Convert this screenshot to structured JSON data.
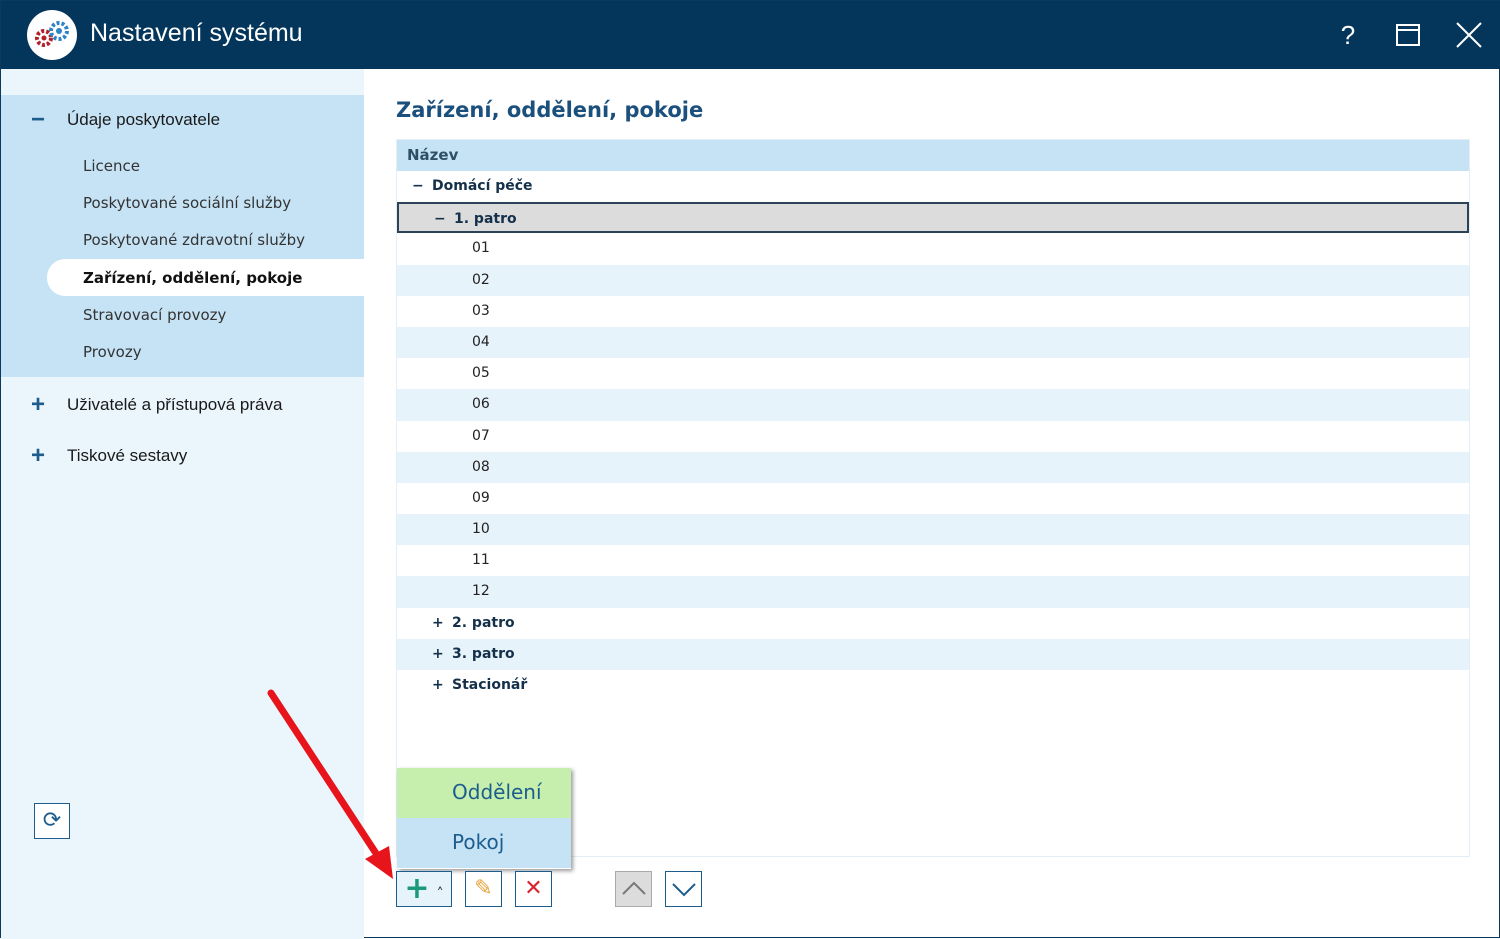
{
  "window": {
    "title": "Nastavení systému",
    "help": "?",
    "maximize": "☐",
    "close": "✕"
  },
  "sidebar": {
    "sections": [
      {
        "label": "Údaje poskytovatele",
        "toggle": "−",
        "items": [
          "Licence",
          "Poskytované sociální služby",
          "Poskytované zdravotní služby",
          "Zařízení, oddělení, pokoje",
          "Stravovací provozy",
          "Provozy"
        ],
        "selected": "Zařízení, oddělení, pokoje"
      },
      {
        "label": "Uživatelé a přístupová práva",
        "toggle": "+"
      },
      {
        "label": "Tiskové sestavy",
        "toggle": "+"
      }
    ],
    "refresh": "⟳"
  },
  "main": {
    "title": "Zařízení, oddělení, pokoje",
    "column": "Název",
    "rows": [
      {
        "toggle": "−",
        "label": "Domácí péče",
        "level": 0
      },
      {
        "toggle": "−",
        "label": "1. patro",
        "level": 1
      },
      {
        "label": "01",
        "level": 2
      },
      {
        "label": "02",
        "level": 2
      },
      {
        "label": "03",
        "level": 2
      },
      {
        "label": "04",
        "level": 2
      },
      {
        "label": "05",
        "level": 2
      },
      {
        "label": "06",
        "level": 2
      },
      {
        "label": "07",
        "level": 2
      },
      {
        "label": "08",
        "level": 2
      },
      {
        "label": "09",
        "level": 2
      },
      {
        "label": "10",
        "level": 2
      },
      {
        "label": "11",
        "level": 2
      },
      {
        "label": "12",
        "level": 2
      },
      {
        "toggle": "+",
        "label": "2. patro",
        "level": 1
      },
      {
        "toggle": "+",
        "label": "3. patro",
        "level": 1
      },
      {
        "toggle": "+",
        "label": "Stacionář",
        "level": 1
      }
    ]
  },
  "popup": {
    "items": [
      "Oddělení",
      "Pokoj"
    ]
  },
  "toolbar": {
    "add": "+",
    "caret": "˄",
    "edit": "✎",
    "delete": "✕",
    "up": "˄",
    "down": "˅"
  }
}
